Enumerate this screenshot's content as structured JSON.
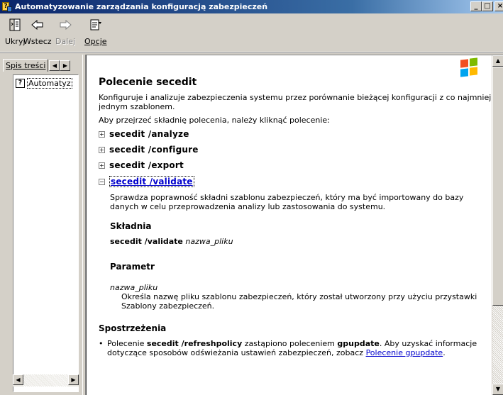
{
  "window": {
    "title": "Automatyzowanie zarządzania konfiguracją zabezpieczeń",
    "controls": [
      "_",
      "□",
      "×"
    ]
  },
  "toolbar": {
    "hide_label": "Ukryj",
    "back_label": "Wstecz",
    "forward_label": "Dalej",
    "options_label": "Opcje"
  },
  "sidebar": {
    "tab_label": "Spis treści",
    "tree_item": "Automatyz"
  },
  "content": {
    "title": "Polecenie secedit",
    "intro": "Konfiguruje i analizuje zabezpieczenia systemu przez porównanie bieżącej konfiguracji z co najmniej jednym szablonem.",
    "instruction": "Aby przejrzeć składnię polecenia, należy kliknąć polecenie:",
    "commands": [
      {
        "expander": "+",
        "label": "secedit /analyze"
      },
      {
        "expander": "+",
        "label": "secedit /configure"
      },
      {
        "expander": "+",
        "label": "secedit /export"
      },
      {
        "expander": "−",
        "label": "secedit /validate"
      }
    ],
    "validate_desc": "Sprawdza poprawność składni szablonu zabezpieczeń, który ma być importowany do bazy danych w celu przeprowadzenia analizy lub zastosowania do systemu.",
    "syntax_heading": "Składnia",
    "syntax_cmd": "secedit /validate",
    "syntax_arg": "nazwa_pliku",
    "param_heading": "Parametr",
    "param_name": "nazwa_pliku",
    "param_desc": "Określa nazwę pliku szablonu zabezpieczeń, który został utworzony przy użyciu przystawki Szablony zabezpieczeń.",
    "remarks_heading": "Spostrzeżenia",
    "remark_pre": "Polecenie ",
    "remark_cmd": "secedit /refreshpolicy",
    "remark_mid": " zastąpiono poleceniem ",
    "remark_gp": "gpupdate",
    "remark_post": ". Aby uzyskać informacje dotyczące sposobów odświeżania ustawień zabezpieczeń, zobacz ",
    "remark_link": "Polecenie gpupdate",
    "remark_end": "."
  },
  "icons": {
    "hide": "hide-pane-icon",
    "back": "back-arrow-icon",
    "forward": "forward-arrow-icon",
    "options": "options-icon",
    "help_page": "help-page-icon",
    "windows_logo": "windows-logo-icon"
  }
}
